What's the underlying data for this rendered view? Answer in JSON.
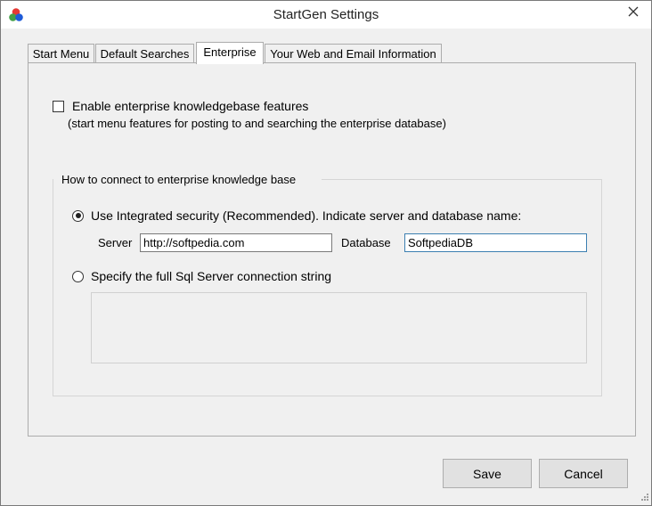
{
  "window": {
    "title": "StartGen Settings",
    "close_label": "×"
  },
  "tabs": [
    {
      "label": "Start Menu",
      "active": false
    },
    {
      "label": "Default Searches",
      "active": false
    },
    {
      "label": "Enterprise",
      "active": true
    },
    {
      "label": "Your Web and Email Information",
      "active": false
    }
  ],
  "enterprise": {
    "enable_label": "Enable enterprise knowledgebase features",
    "enable_checked": false,
    "enable_note": "(start menu features for posting to and searching the enterprise database)",
    "group_title": "How to connect to enterprise knowledge base",
    "integrated_label": "Use Integrated security (Recommended). Indicate server and database name:",
    "integrated_selected": true,
    "server_label": "Server",
    "server_value": "http://softpedia.com",
    "database_label": "Database",
    "database_value": "SoftpediaDB",
    "connection_label": "Specify the full Sql Server connection string",
    "connection_selected": false,
    "connection_value": ""
  },
  "buttons": {
    "save": "Save",
    "cancel": "Cancel"
  },
  "icons": {
    "app": "rgb-circles-icon",
    "close": "close-icon",
    "scroll_up": "scroll-up-arrow-icon",
    "scroll_down": "scroll-down-arrow-icon",
    "resize": "resize-grip-icon"
  }
}
